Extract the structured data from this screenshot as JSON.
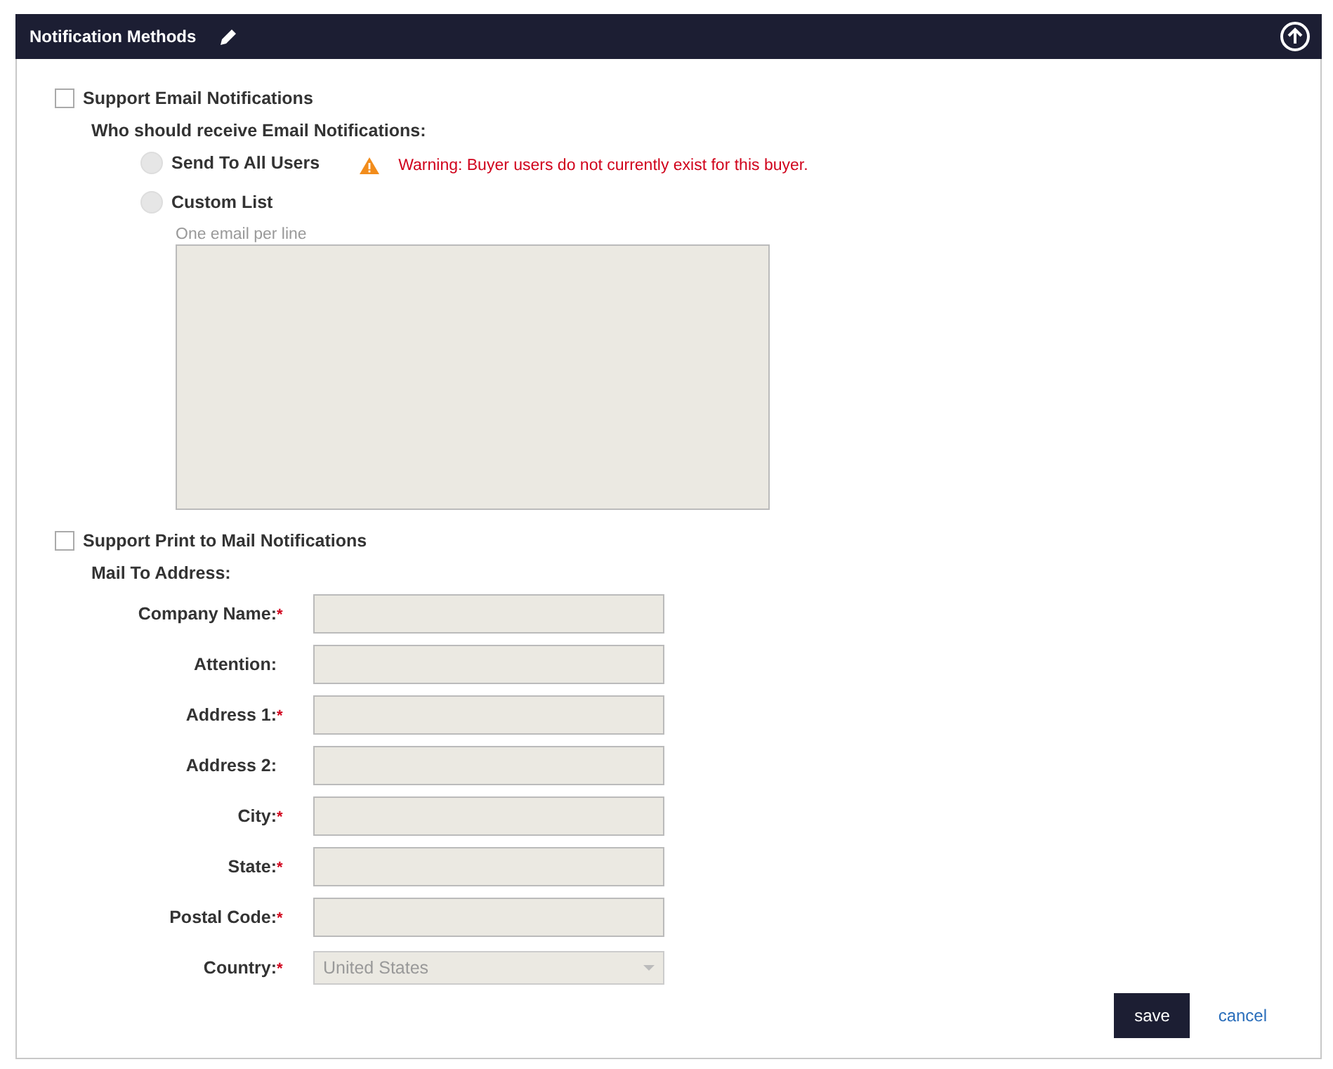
{
  "header": {
    "title": "Notification Methods"
  },
  "email": {
    "label": "Support Email Notifications",
    "checked": false,
    "question": "Who should receive Email Notifications:",
    "options": [
      {
        "label": "Send To All Users",
        "selected": false
      },
      {
        "label": "Custom List",
        "selected": false
      }
    ],
    "warning": "Warning: Buyer users do not currently exist for this buyer.",
    "list_hint": "One email per line"
  },
  "mail": {
    "label": "Support Print to Mail Notifications",
    "checked": false,
    "heading": "Mail To Address:",
    "fields": [
      {
        "label": "Company Name:",
        "required": true,
        "kind": "text"
      },
      {
        "label": "Attention:",
        "required": false,
        "kind": "text"
      },
      {
        "label": "Address 1:",
        "required": true,
        "kind": "text"
      },
      {
        "label": "Address 2:",
        "required": false,
        "kind": "text"
      },
      {
        "label": "City:",
        "required": true,
        "kind": "text"
      },
      {
        "label": "State:",
        "required": true,
        "kind": "text"
      },
      {
        "label": "Postal Code:",
        "required": true,
        "kind": "text"
      },
      {
        "label": "Country:",
        "required": true,
        "kind": "select",
        "value": "United States"
      }
    ]
  },
  "required_mark": "*",
  "buttons": {
    "save": "save",
    "cancel": "cancel"
  }
}
